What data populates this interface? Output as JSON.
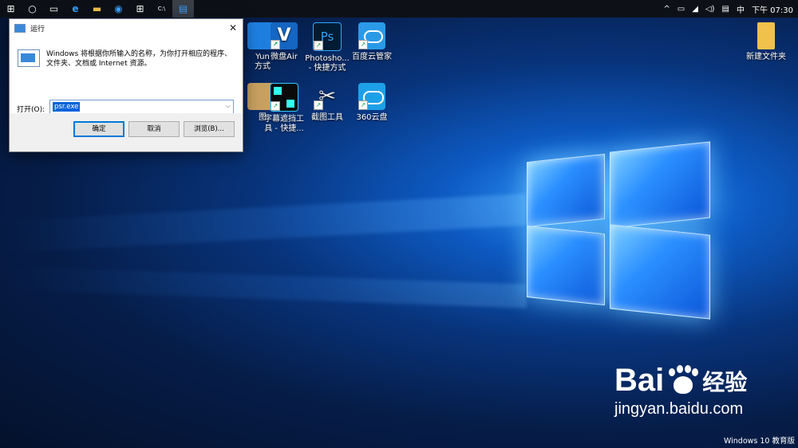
{
  "taskbar": {
    "items": [
      {
        "icon": "windows-start-icon",
        "glyph": "⊞"
      },
      {
        "icon": "cortana-icon",
        "glyph": "○"
      },
      {
        "icon": "task-view-icon",
        "glyph": "▭"
      },
      {
        "icon": "edge-icon",
        "glyph": "e"
      },
      {
        "icon": "file-explorer-icon",
        "glyph": "▬"
      },
      {
        "icon": "browser-icon",
        "glyph": "◉"
      },
      {
        "icon": "store-icon",
        "glyph": "⊞"
      },
      {
        "icon": "cmd-icon",
        "glyph": "C:\\"
      },
      {
        "icon": "run-app-icon",
        "glyph": "▤"
      }
    ],
    "tray": {
      "chevron": "^",
      "battery": "▭",
      "network": "◢",
      "volume": "◁)",
      "notification": "▤",
      "language": "中",
      "clock": "下午 07:30"
    }
  },
  "desktop": {
    "icons": [
      {
        "label_lines": [
          "Yun",
          "方式"
        ]
      },
      {
        "label_lines": [
          "微盘Air"
        ]
      },
      {
        "label_lines": [
          "Photosho...",
          "- 快捷方式"
        ]
      },
      {
        "label_lines": [
          "百度云管家"
        ]
      },
      {
        "label_lines": [
          "图"
        ]
      },
      {
        "label_lines": [
          "字幕遮挡工",
          "具 - 快捷..."
        ]
      },
      {
        "label_lines": [
          "截图工具"
        ]
      },
      {
        "label_lines": [
          "360云盘"
        ]
      },
      {
        "label_lines": [
          "新建文件夹"
        ]
      }
    ],
    "watermark": "Windows 10 教育版",
    "baidu": {
      "brand_text": "Bai",
      "brand_suffix": "经验",
      "url": "jingyan.baidu.com"
    }
  },
  "run_dialog": {
    "title": "运行",
    "close": "✕",
    "description": "Windows 将根据你所输入的名称，为你打开相应的程序、文件夹、文档或 Internet 资源。",
    "open_label": "打开(O):",
    "input_value": "psr.exe",
    "buttons": {
      "ok": "确定",
      "cancel": "取消",
      "browse": "浏览(B)..."
    }
  },
  "colors": {
    "accent": "#0078d7",
    "taskbar": "#0d1117",
    "selection": "#0a64d6"
  }
}
